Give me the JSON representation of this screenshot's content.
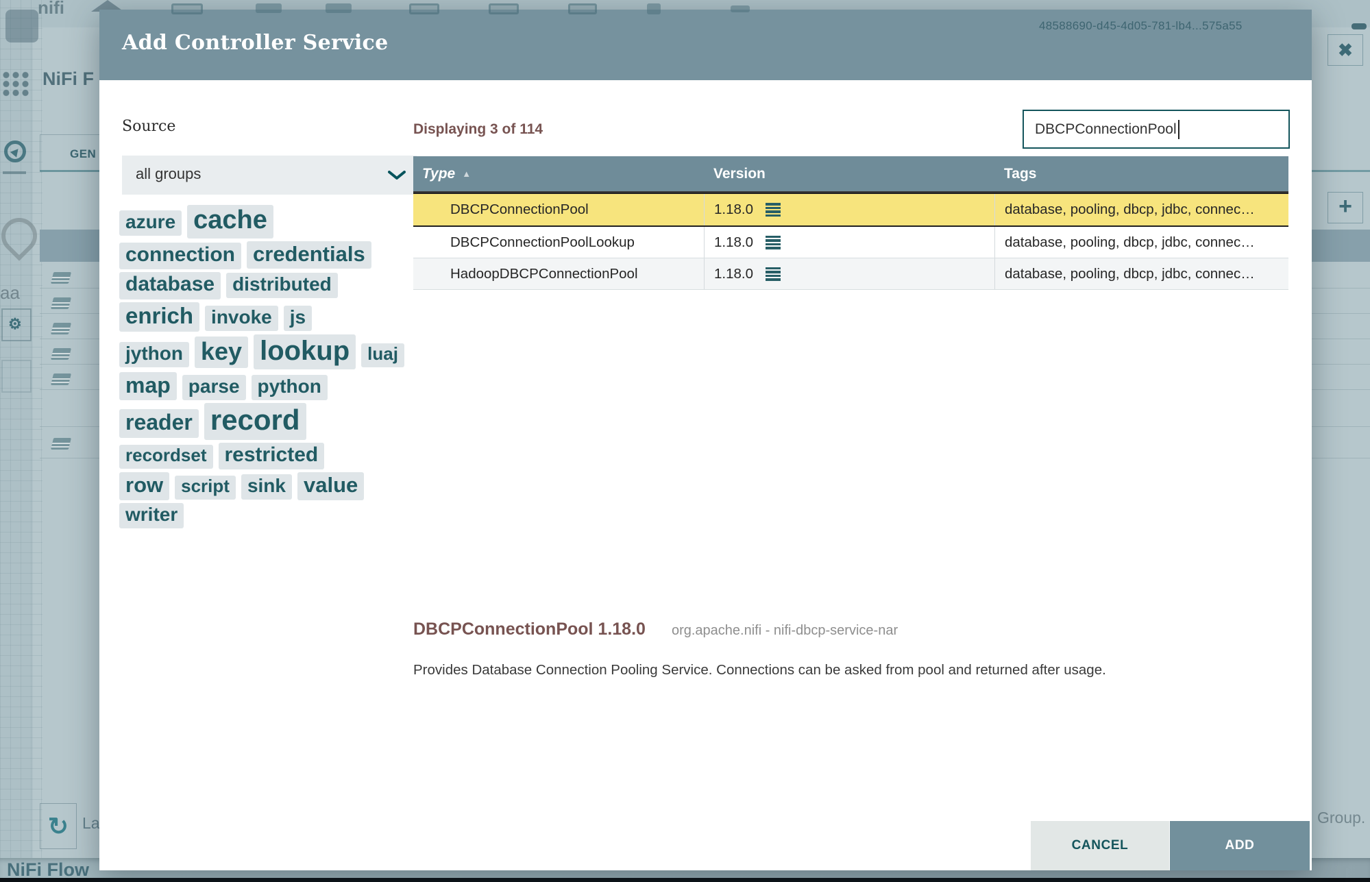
{
  "backdrop": {
    "page_title_partial": "NiFi F",
    "tab_label_partial": "GEN",
    "uuid_text": "48588690-d45-4d05-781-lb4...575a55",
    "last_updated_partial": "La",
    "group_text_partial": "Group.",
    "breadcrumb": "NiFi Flow",
    "refresh_icon_glyph": "↻",
    "close_icon_glyph": "✖",
    "add_icon_glyph": "+"
  },
  "dialog": {
    "title": "Add Controller Service",
    "source": {
      "label": "Source",
      "selected_value": "all groups"
    },
    "displaying_text": "Displaying 3 of 114",
    "filter": {
      "value": "DBCPConnectionPool"
    },
    "table": {
      "columns": [
        "Type",
        "Version",
        "Tags"
      ],
      "sorted_column": "Type",
      "sort_direction": "ascending",
      "sort_arrow_glyph": "▲",
      "rows": [
        {
          "type": "DBCPConnectionPool",
          "version": "1.18.0",
          "tags": "database, pooling, dbcp, jdbc, connec…",
          "selected": true
        },
        {
          "type": "DBCPConnectionPoolLookup",
          "version": "1.18.0",
          "tags": "database, pooling, dbcp, jdbc, connec…",
          "selected": false
        },
        {
          "type": "HadoopDBCPConnectionPool",
          "version": "1.18.0",
          "tags": "database, pooling, dbcp, jdbc, connec…",
          "selected": false
        }
      ]
    },
    "tag_cloud": [
      [
        {
          "label": "azure",
          "size": 28
        },
        {
          "label": "cache",
          "size": 38
        }
      ],
      [
        {
          "label": "connection",
          "size": 30
        },
        {
          "label": "credentials",
          "size": 31
        }
      ],
      [
        {
          "label": "database",
          "size": 30
        },
        {
          "label": "distributed",
          "size": 28
        }
      ],
      [
        {
          "label": "enrich",
          "size": 33
        },
        {
          "label": "invoke",
          "size": 28
        },
        {
          "label": "js",
          "size": 28
        }
      ],
      [
        {
          "label": "jython",
          "size": 28
        },
        {
          "label": "key",
          "size": 36
        },
        {
          "label": "lookup",
          "size": 40
        },
        {
          "label": "luaj",
          "size": 26
        }
      ],
      [
        {
          "label": "map",
          "size": 32
        },
        {
          "label": "parse",
          "size": 28
        },
        {
          "label": "python",
          "size": 28
        }
      ],
      [
        {
          "label": "reader",
          "size": 32
        },
        {
          "label": "record",
          "size": 42
        }
      ],
      [
        {
          "label": "recordset",
          "size": 26
        },
        {
          "label": "restricted",
          "size": 30
        }
      ],
      [
        {
          "label": "row",
          "size": 31
        },
        {
          "label": "script",
          "size": 26
        },
        {
          "label": "sink",
          "size": 28
        },
        {
          "label": "value",
          "size": 31
        }
      ],
      [
        {
          "label": "writer",
          "size": 28
        }
      ]
    ],
    "detail": {
      "title": "DBCPConnectionPool 1.18.0",
      "bundle": "org.apache.nifi - nifi-dbcp-service-nar",
      "description": "Provides Database Connection Pooling Service. Connections can be asked from pool and returned after usage."
    },
    "buttons": {
      "cancel": "CANCEL",
      "add": "ADD"
    }
  },
  "colors": {
    "modal_header": "#76929e",
    "table_header": "#6f8c99",
    "selected_row": "#f7e47d",
    "accent_maroon": "#775351",
    "accent_teal": "#14555c",
    "tag_text": "#215b63",
    "tag_pill_bg": "#dfe5e8",
    "add_button_bg": "#72909c",
    "cancel_button_bg": "#e2e7e6",
    "backdrop_base": "#adc0c6"
  }
}
